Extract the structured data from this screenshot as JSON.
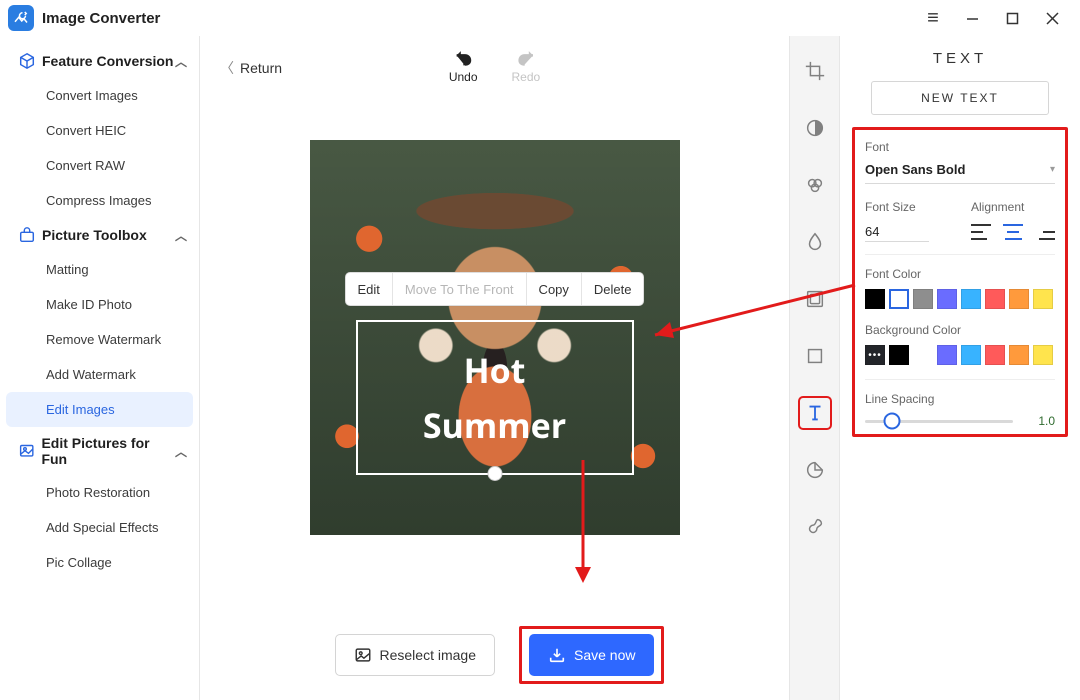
{
  "app": {
    "title": "Image Converter"
  },
  "sidebar": {
    "sections": [
      {
        "label": "Feature Conversion",
        "items": [
          {
            "label": "Convert Images"
          },
          {
            "label": "Convert HEIC"
          },
          {
            "label": "Convert RAW"
          },
          {
            "label": "Compress Images"
          }
        ]
      },
      {
        "label": "Picture Toolbox",
        "items": [
          {
            "label": "Matting"
          },
          {
            "label": "Make ID Photo"
          },
          {
            "label": "Remove Watermark"
          },
          {
            "label": "Add Watermark"
          },
          {
            "label": "Edit Images"
          }
        ]
      },
      {
        "label": "Edit Pictures for Fun",
        "items": [
          {
            "label": "Photo Restoration"
          },
          {
            "label": "Add Special Effects"
          },
          {
            "label": "Pic Collage"
          }
        ]
      }
    ]
  },
  "editor": {
    "return_label": "Return",
    "undo_label": "Undo",
    "redo_label": "Redo",
    "context_menu": {
      "edit": "Edit",
      "move_front": "Move To The Front",
      "copy": "Copy",
      "delete": "Delete"
    },
    "canvas_text": "Hot\nSummer",
    "reselect_label": "Reselect image",
    "save_label": "Save now"
  },
  "text_panel": {
    "title": "TEXT",
    "new_text_label": "NEW TEXT",
    "font_label": "Font",
    "font_value": "Open Sans Bold",
    "font_size_label": "Font Size",
    "font_size_value": "64",
    "alignment_label": "Alignment",
    "alignment_value": "center",
    "font_color_label": "Font Color",
    "font_colors": [
      "#000000",
      "#ffffff",
      "#8e8e8e",
      "#6a6cff",
      "#38b3ff",
      "#ff5a5a",
      "#ff9a3c",
      "#ffe44d"
    ],
    "font_color_selected_index": 1,
    "bg_color_label": "Background Color",
    "bg_colors": [
      "#000000",
      "#6a6cff",
      "#38b3ff",
      "#ff5a5a",
      "#ff9a3c",
      "#ffe44d"
    ],
    "line_spacing_label": "Line Spacing",
    "line_spacing_value": "1.0"
  }
}
